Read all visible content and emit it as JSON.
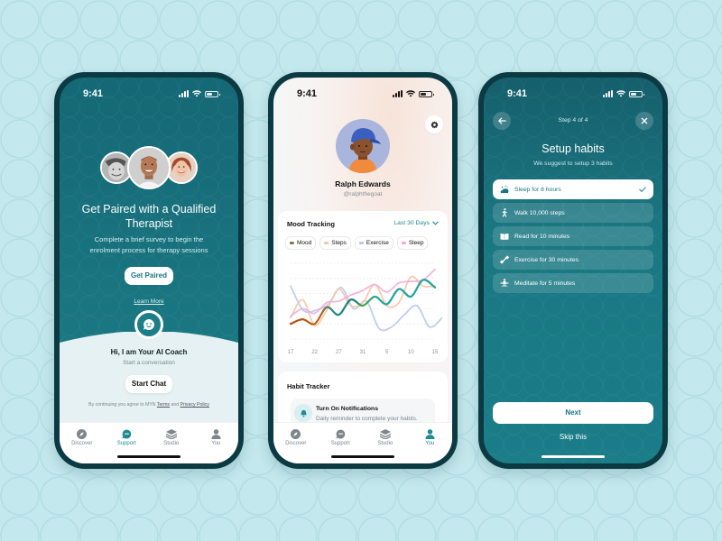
{
  "status_bar": {
    "time": "9:41"
  },
  "tab_bar": {
    "items": [
      {
        "label": "Discover",
        "icon": "compass-icon"
      },
      {
        "label": "Support",
        "icon": "chat-bubble-icon"
      },
      {
        "label": "Studio",
        "icon": "layers-icon"
      },
      {
        "label": "You",
        "icon": "person-icon"
      }
    ]
  },
  "screen1": {
    "title": "Get Paired with a Qualified Therapist",
    "subtitle": "Complete a brief survey to begin the enrolment process for therapy sessions",
    "primary_button": "Get Paired",
    "learn_more": "Learn More",
    "coach_title": "Hi, I am Your AI Coach",
    "coach_subtitle": "Start a conversation",
    "chat_button": "Start Chat",
    "legal_prefix": "By continuing you agree to MYN",
    "legal_terms": "Terms",
    "legal_and": "and",
    "legal_privacy": "Privacy Policy",
    "active_tab": "Support"
  },
  "screen2": {
    "name": "Ralph Edwards",
    "handle": "@ralphthegoat",
    "mood_card": {
      "title": "Mood Tracking",
      "range_selector": "Last 30 Days",
      "chips": [
        {
          "label": "Mood",
          "color": "#4fa27a"
        },
        {
          "label": "Steps",
          "color": "#f5c6a5"
        },
        {
          "label": "Exercise",
          "color": "#b7c9f2"
        },
        {
          "label": "Sleep",
          "color": "#f0a9db"
        }
      ]
    },
    "habit_card": {
      "title": "Habit Tracker",
      "notification_title": "Turn On Notifications",
      "notification_subtitle": "Daily reminder to complete your habits."
    },
    "active_tab": "You",
    "chart_data": {
      "type": "line",
      "title": "Mood Tracking",
      "x": [
        "17",
        "22",
        "27",
        "31",
        "5",
        "10",
        "15"
      ],
      "xlabel": "",
      "ylabel": "",
      "ylim": [
        0,
        5
      ],
      "grid": true,
      "series": [
        {
          "name": "Mood",
          "values": [
            1.0,
            1.3,
            1.0,
            2.1,
            1.6,
            2.6,
            2.2,
            2.8,
            2.3,
            3.3,
            2.8,
            3.9,
            3.4
          ]
        },
        {
          "name": "Steps",
          "values": [
            1.4,
            2.6,
            0.9,
            1.9,
            3.3,
            2.2,
            2.4,
            3.6,
            2.2,
            2.4,
            4.1,
            3.5,
            3.5
          ]
        },
        {
          "name": "Exercise",
          "values": [
            3.5,
            1.9,
            1.9,
            2.3,
            3.4,
            2.0,
            2.5,
            0.7,
            0.8,
            1.6,
            2.2,
            0.8,
            1.4
          ]
        },
        {
          "name": "Sleep",
          "values": [
            1.5,
            2.0,
            1.7,
            2.4,
            2.5,
            2.9,
            3.2,
            3.6,
            3.1,
            3.7,
            3.8,
            3.9,
            4.6
          ]
        }
      ]
    }
  },
  "screen3": {
    "step_label": "Step 4 of 4",
    "title": "Setup habits",
    "subtitle": "We suggest to setup 3 habits",
    "habits": [
      {
        "label": "Sleep for 8 hours",
        "icon": "sleep-icon",
        "selected": true
      },
      {
        "label": "Walk 10,000 steps",
        "icon": "walk-icon",
        "selected": false
      },
      {
        "label": "Read for 10 minutes",
        "icon": "book-icon",
        "selected": false
      },
      {
        "label": "Exercise for 30 minutes",
        "icon": "dumbbell-icon",
        "selected": false
      },
      {
        "label": "Meditate for 5 minutes",
        "icon": "meditate-icon",
        "selected": false
      }
    ],
    "next_button": "Next",
    "skip_link": "Skip this"
  },
  "colors": {
    "brand_teal": "#1a7782",
    "background": "#c3e8ed",
    "phone_frame": "#0c3a42"
  }
}
